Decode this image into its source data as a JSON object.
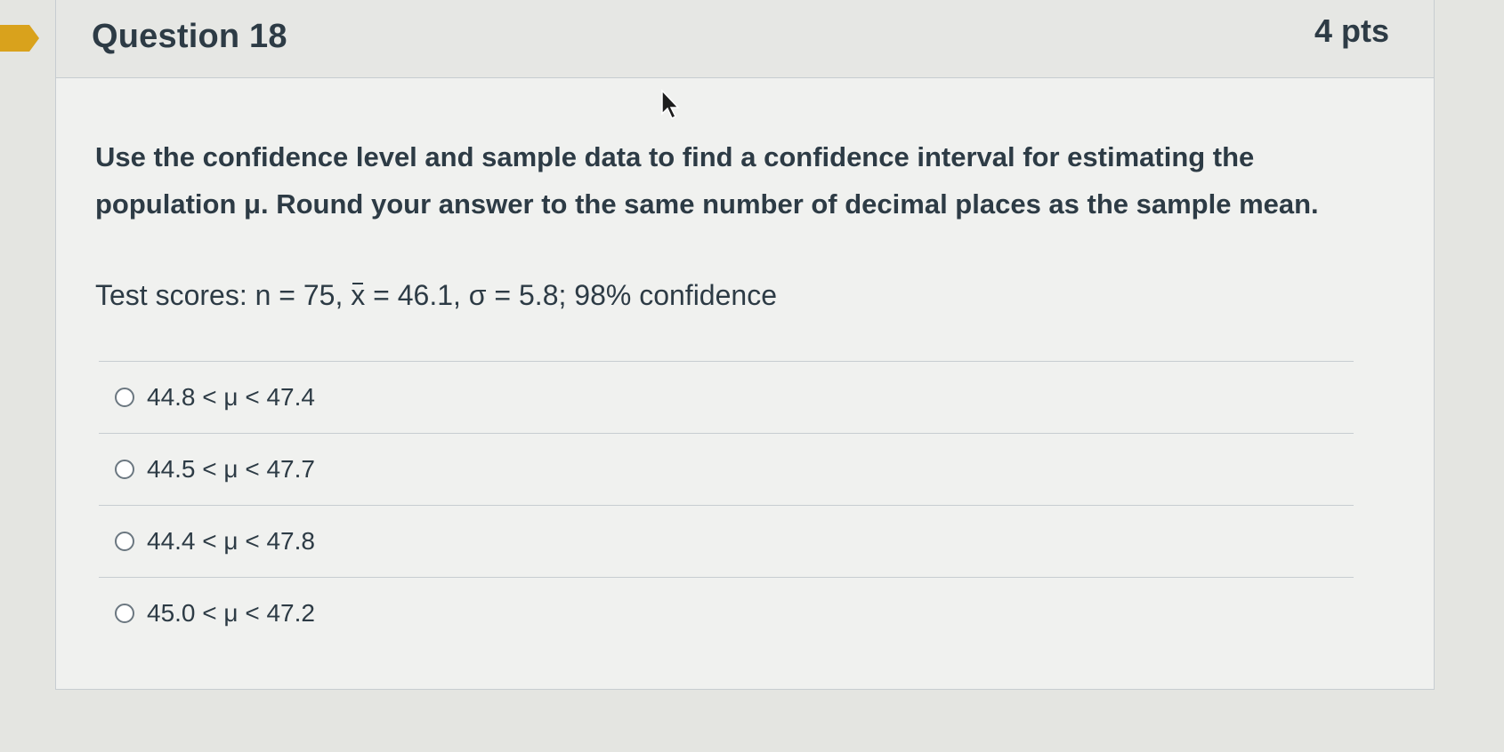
{
  "question": {
    "title": "Question 18",
    "points": "4 pts",
    "prompt": "Use the confidence level and sample data to find a confidence interval for estimating the population μ. Round your answer to the same number of decimal places as the sample mean.",
    "given": {
      "prefix": "Test scores: n = 75, ",
      "xbar_symbol": "x",
      "middle": " = 46.1, σ = 5.8; 98% confidence"
    }
  },
  "answers": [
    {
      "label": "44.8 < μ < 47.4"
    },
    {
      "label": "44.5 < μ < 47.7"
    },
    {
      "label": "44.4 < μ < 47.8"
    },
    {
      "label": "45.0 < μ < 47.2"
    }
  ],
  "colors": {
    "background": "#e4e5e1",
    "text": "#2d3b45",
    "flag": "#d9a21c",
    "border": "#c7cdd1"
  },
  "icons": {
    "flag": "bookmark-flag-icon",
    "cursor": "mouse-pointer-icon"
  }
}
